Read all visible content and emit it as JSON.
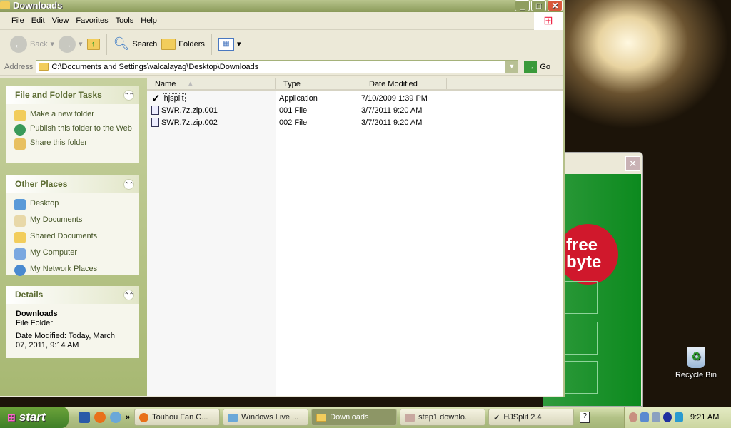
{
  "window": {
    "title": "Downloads",
    "minimize": "_",
    "maximize": "□",
    "close": "✕"
  },
  "menu": [
    "File",
    "Edit",
    "View",
    "Favorites",
    "Tools",
    "Help"
  ],
  "toolbar": {
    "back": "Back",
    "search": "Search",
    "folders": "Folders"
  },
  "address": {
    "label": "Address",
    "path": "C:\\Documents and Settings\\valcalayag\\Desktop\\Downloads",
    "go": "Go"
  },
  "tasks": {
    "title": "File and Folder Tasks",
    "items": [
      "Make a new folder",
      "Publish this folder to the Web",
      "Share this folder"
    ]
  },
  "places": {
    "title": "Other Places",
    "items": [
      "Desktop",
      "My Documents",
      "Shared Documents",
      "My Computer",
      "My Network Places"
    ]
  },
  "details": {
    "title": "Details",
    "name": "Downloads",
    "type": "File Folder",
    "modified": "Date Modified: Today, March 07, 2011, 9:14 AM"
  },
  "columns": [
    "Name",
    "Type",
    "Date Modified"
  ],
  "files": [
    {
      "name": "hjsplit",
      "type": "Application",
      "date": "7/10/2009 1:39 PM",
      "icon": "checkmark-icon"
    },
    {
      "name": "SWR.7z.zip.001",
      "type": "001 File",
      "date": "3/7/2011 9:20 AM",
      "icon": "file-icon"
    },
    {
      "name": "SWR.7z.zip.002",
      "type": "002 File",
      "date": "3/7/2011 9:20 AM",
      "icon": "file-icon"
    }
  ],
  "dialog": {
    "logo": "free byte",
    "close": "✕"
  },
  "desktop": {
    "recycle": "Recycle Bin"
  },
  "taskbar": {
    "start": "start",
    "more": "»",
    "tasks": [
      {
        "label": "Touhou Fan C...",
        "active": false
      },
      {
        "label": "Windows Live ...",
        "active": false
      },
      {
        "label": "Downloads",
        "active": true
      },
      {
        "label": "step1 downlo...",
        "active": false
      },
      {
        "label": "HJSplit 2.4",
        "active": false
      }
    ],
    "clock": "9:21 AM"
  }
}
